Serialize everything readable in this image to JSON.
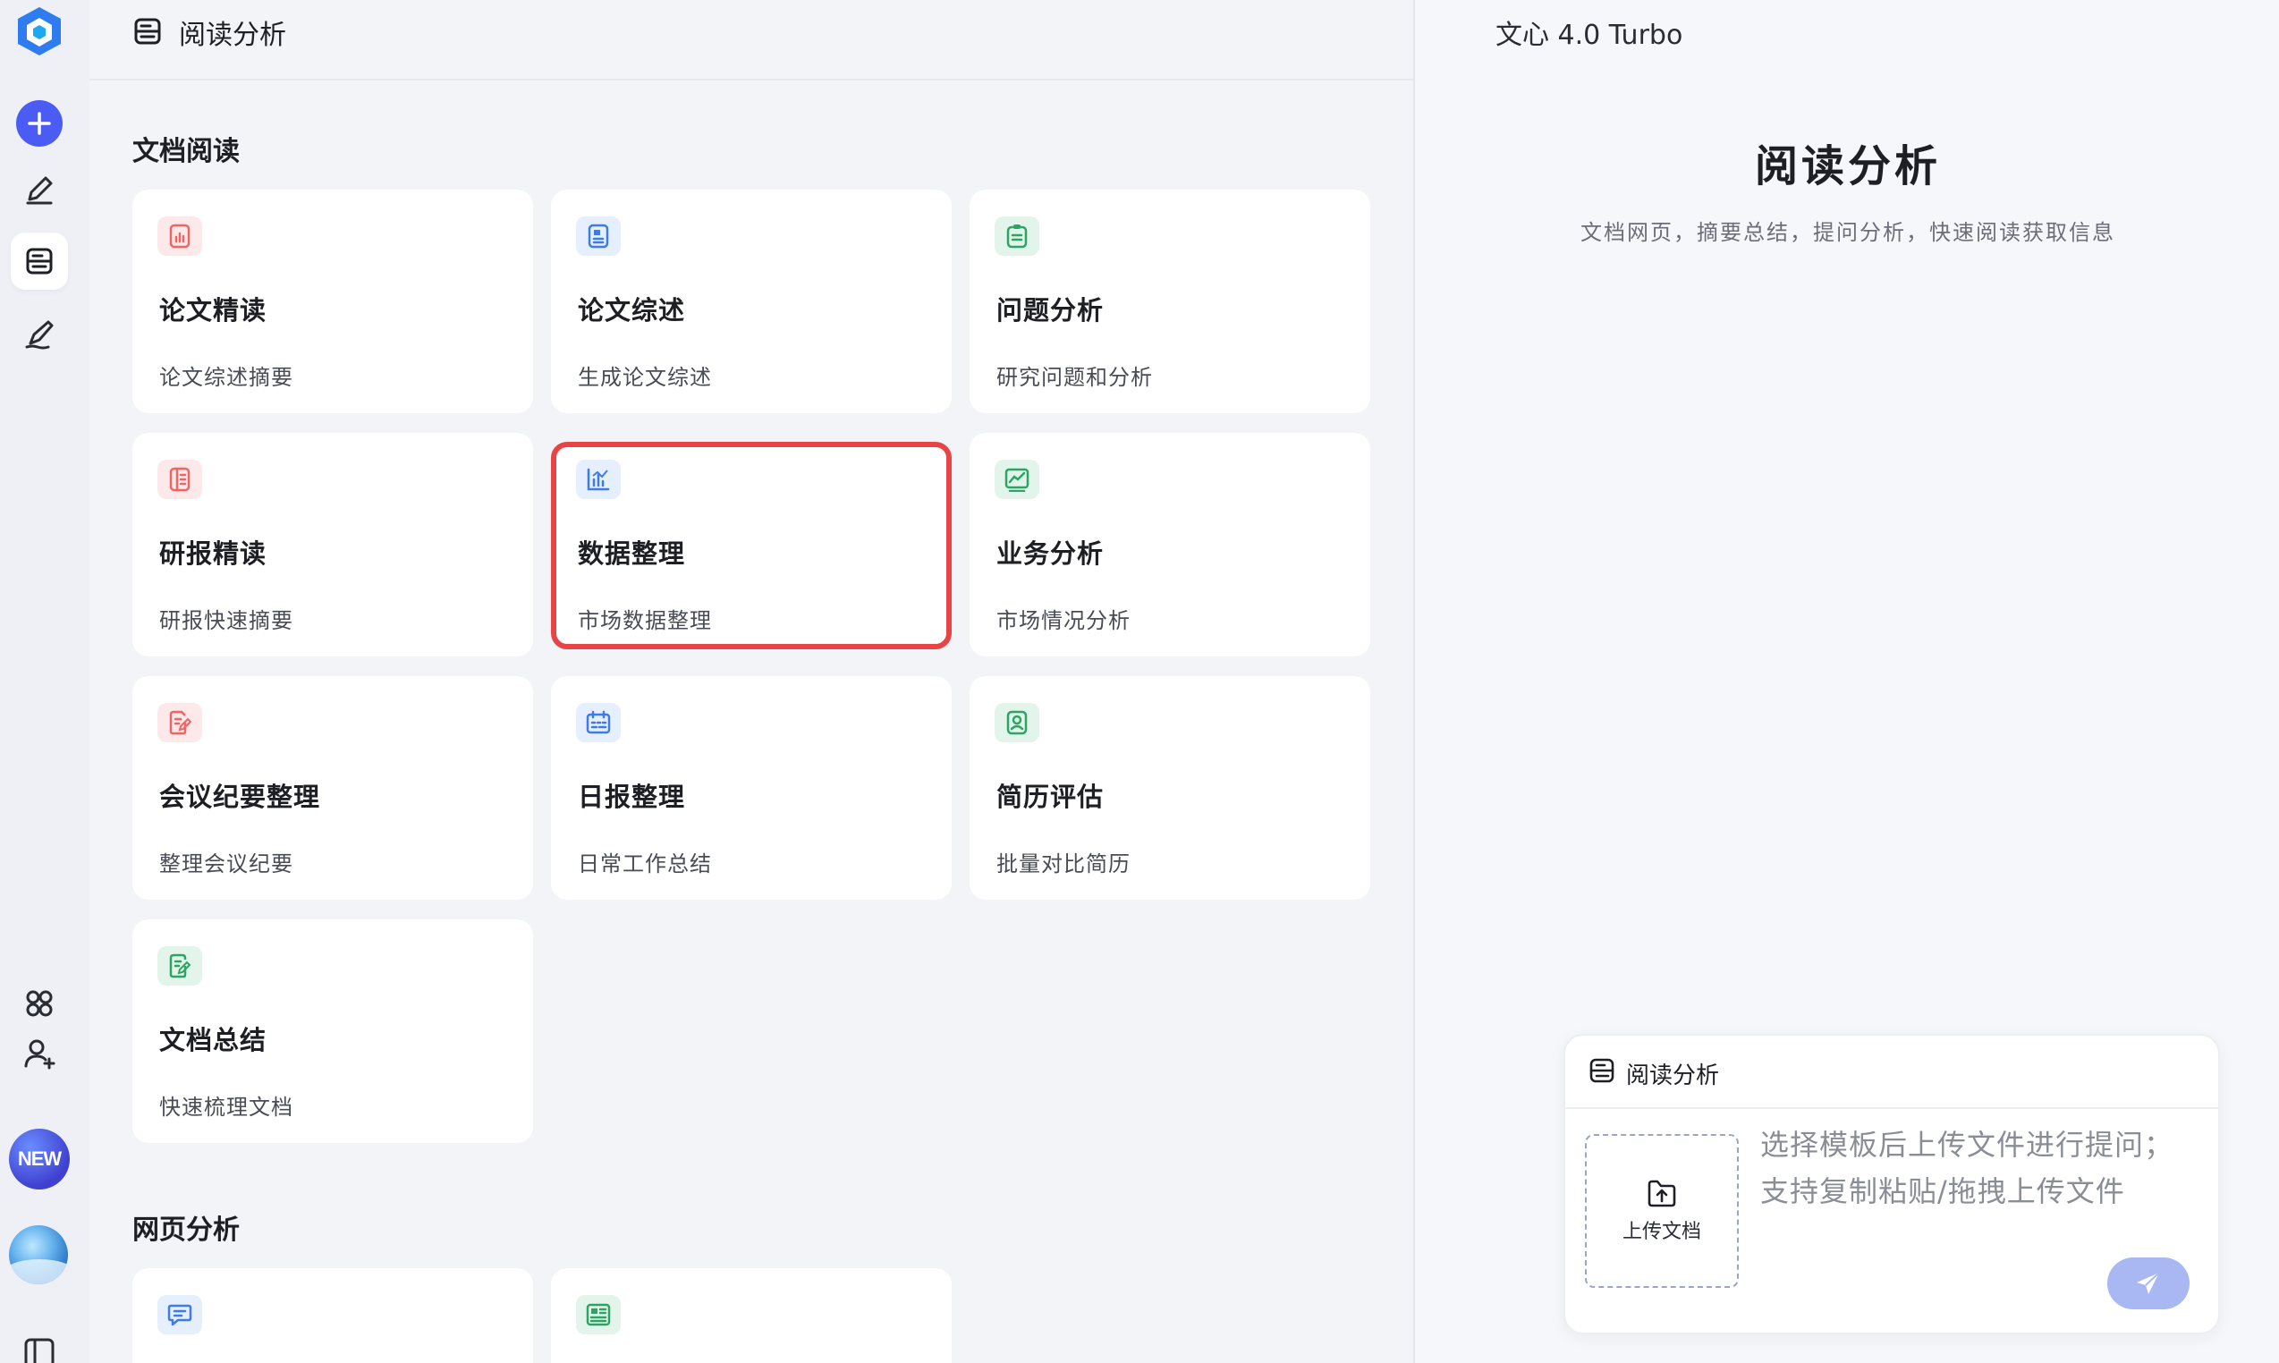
{
  "app": {
    "header_title": "阅读分析",
    "model_name": "文心 4.0 Turbo",
    "new_badge": "NEW"
  },
  "sections": [
    {
      "title": "文档阅读",
      "cards": [
        {
          "title": "论文精读",
          "subtitle": "论文综述摘要",
          "icon": "doc-chart-icon",
          "tone": "red"
        },
        {
          "title": "论文综述",
          "subtitle": "生成论文综述",
          "icon": "doc-list-icon",
          "tone": "blue"
        },
        {
          "title": "问题分析",
          "subtitle": "研究问题和分析",
          "icon": "clipboard-icon",
          "tone": "green"
        },
        {
          "title": "研报精读",
          "subtitle": "研报快速摘要",
          "icon": "report-icon",
          "tone": "red"
        },
        {
          "title": "数据整理",
          "subtitle": "市场数据整理",
          "icon": "bar-chart-icon",
          "tone": "blue",
          "selected": true
        },
        {
          "title": "业务分析",
          "subtitle": "市场情况分析",
          "icon": "line-chart-icon",
          "tone": "green"
        },
        {
          "title": "会议纪要整理",
          "subtitle": "整理会议纪要",
          "icon": "doc-edit-icon",
          "tone": "red"
        },
        {
          "title": "日报整理",
          "subtitle": "日常工作总结",
          "icon": "calendar-icon",
          "tone": "blue"
        },
        {
          "title": "简历评估",
          "subtitle": "批量对比简历",
          "icon": "resume-icon",
          "tone": "green"
        },
        {
          "title": "文档总结",
          "subtitle": "快速梳理文档",
          "icon": "doc-pen-icon",
          "tone": "green"
        }
      ]
    },
    {
      "title": "网页分析",
      "cards": [
        {
          "icon": "chat-bubble-icon",
          "tone": "blue"
        },
        {
          "icon": "news-icon",
          "tone": "green"
        }
      ]
    }
  ],
  "right": {
    "title": "阅读分析",
    "subtitle": "文档网页，摘要总结，提问分析，快速阅读获取信息",
    "composer": {
      "mode_label": "阅读分析",
      "upload_label": "上传文档",
      "placeholder_line1": "选择模板后上传文件进行提问；",
      "placeholder_line2": "支持复制粘贴/拖拽上传文件"
    }
  },
  "colors": {
    "accent": "#4b5cf5",
    "selected_outline": "#e74545",
    "icon_red": "#f06464",
    "icon_blue": "#3d7be8",
    "icon_green": "#2aa564"
  }
}
